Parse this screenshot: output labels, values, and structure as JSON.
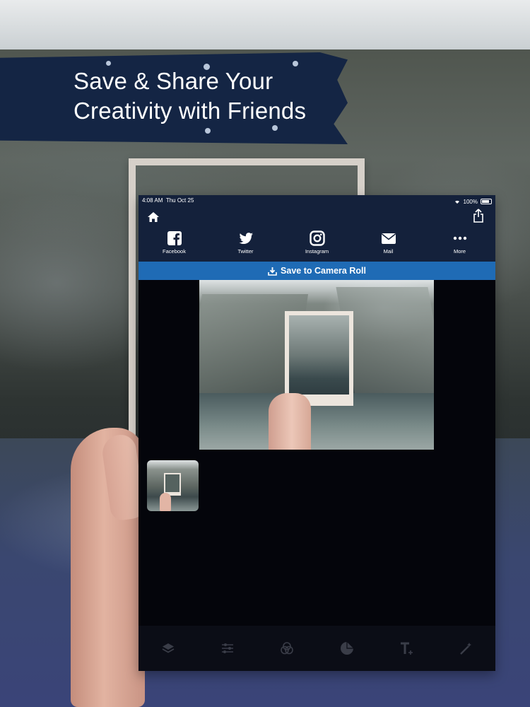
{
  "headline": {
    "line1": "Save & Share Your",
    "line2": "Creativity with Friends"
  },
  "status_bar": {
    "time": "4:08 AM",
    "date": "Thu Oct 25",
    "battery": "100%"
  },
  "share_targets": [
    {
      "label": "Facebook",
      "icon": "facebook-icon"
    },
    {
      "label": "Twitter",
      "icon": "twitter-icon"
    },
    {
      "label": "Instagram",
      "icon": "instagram-icon"
    },
    {
      "label": "Mail",
      "icon": "mail-icon"
    },
    {
      "label": "More",
      "icon": "more-icon"
    }
  ],
  "save_button": {
    "label": "Save to Camera Roll",
    "icon": "download-icon",
    "color": "#1f6bb5"
  },
  "toolbar_icons": [
    "layers-icon",
    "adjust-sliders-icon",
    "blend-circles-icon",
    "sticker-icon",
    "text-add-icon",
    "magic-wand-icon"
  ],
  "colors": {
    "topbar": "#14213b",
    "banner": "#142544",
    "screen_bg": "#04050b"
  }
}
